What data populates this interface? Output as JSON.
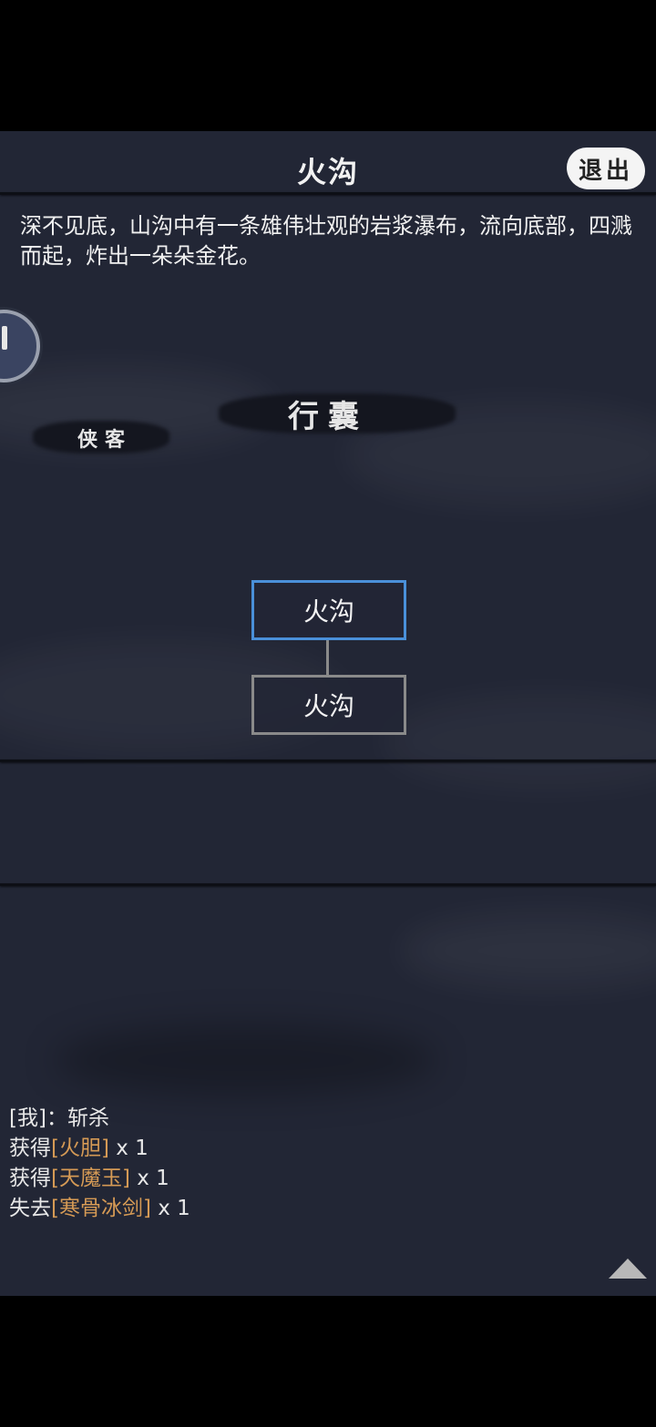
{
  "header": {
    "title": "火沟",
    "exit_label": "退出"
  },
  "description": "深不见底，山沟中有一条雄伟壮观的岩浆瀑布，流向底部，四溅而起，炸出一朵朵金花。",
  "labels": {
    "hero": "侠客",
    "bag": "行囊"
  },
  "map_nodes": [
    {
      "label": "火沟",
      "state": "current"
    },
    {
      "label": "火沟",
      "state": "normal"
    }
  ],
  "log": [
    {
      "prefix": "[我]：斩杀",
      "item": "",
      "suffix": ""
    },
    {
      "prefix": "获得",
      "item": "[火胆]",
      "suffix": " x 1"
    },
    {
      "prefix": "获得",
      "item": "[天魔玉]",
      "suffix": " x 1"
    },
    {
      "prefix": "失去",
      "item": "[寒骨冰剑]",
      "suffix": " x 1"
    }
  ],
  "colors": {
    "background": "#222635",
    "active_node_border": "#4a90d9",
    "item_text": "#d59a55"
  },
  "icons": {
    "scroll_up": "triangle-up-icon",
    "side_badge": "character-portrait-icon"
  }
}
